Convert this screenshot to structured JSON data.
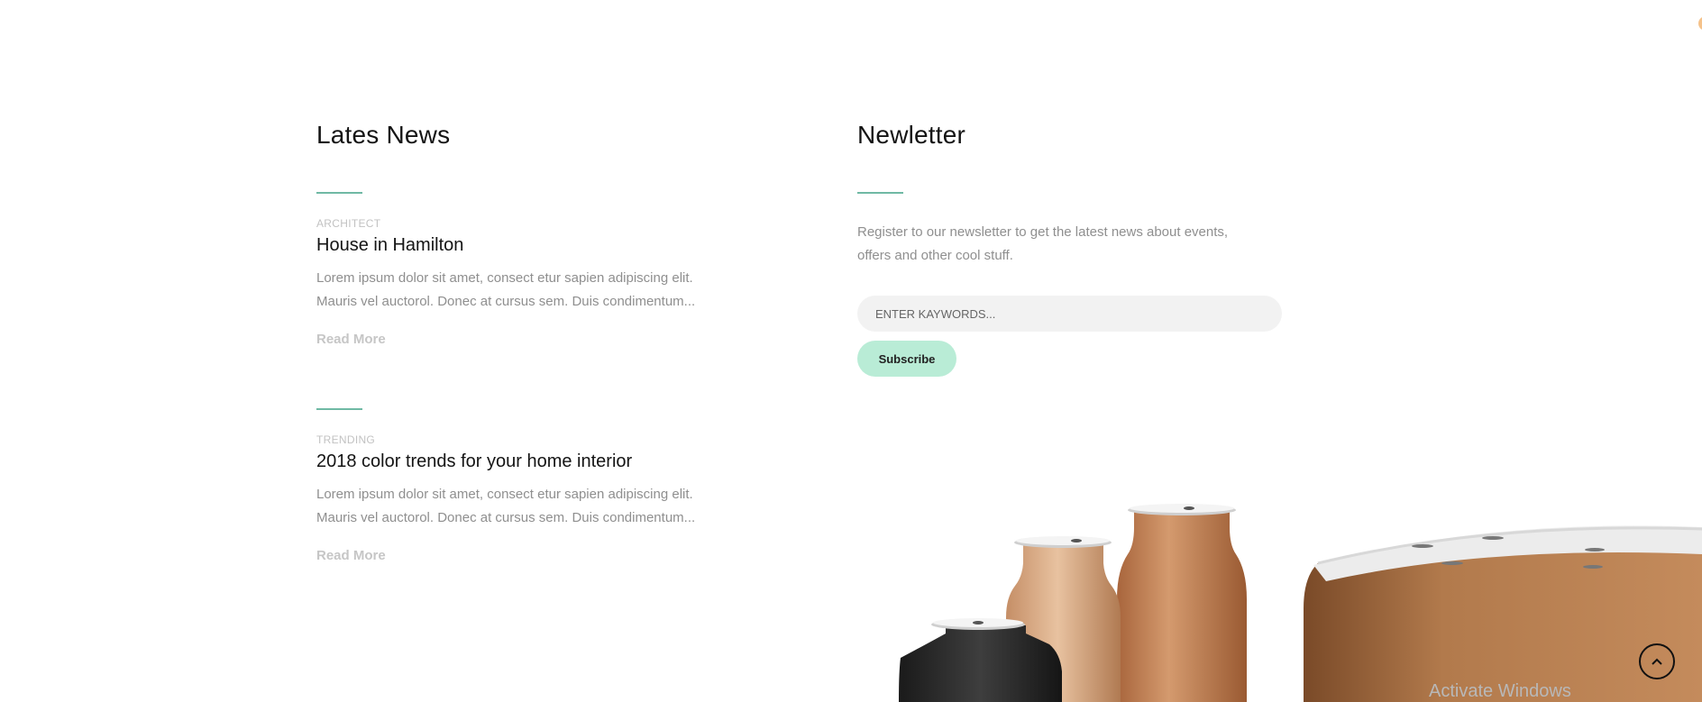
{
  "latest_news": {
    "title": "Lates News",
    "posts": [
      {
        "category": "ARCHITECT",
        "title": "House in Hamilton",
        "excerpt_line1": "Lorem ipsum dolor sit amet, consect etur sapien adipiscing elit.",
        "excerpt_line2": "Mauris vel auctorol. Donec at cursus sem. Duis condimentum...",
        "read_more": "Read More"
      },
      {
        "category": "TRENDING",
        "title": "2018 color trends for your home interior",
        "excerpt_line1": "Lorem ipsum dolor sit amet, consect etur sapien adipiscing elit.",
        "excerpt_line2": "Mauris vel auctorol. Donec at cursus sem. Duis condimentum...",
        "read_more": "Read More"
      }
    ]
  },
  "newsletter": {
    "title": "Newletter",
    "description_line1": "Register to our newsletter to get the latest news about events,",
    "description_line2": "offers and other cool stuff.",
    "input_placeholder": "ENTER KAYWORDS...",
    "input_value": "",
    "subscribe_label": "Subscribe"
  },
  "overlay": {
    "watermark": "Activate Windows"
  },
  "icons": {
    "scroll_top": "chevron-up-icon"
  },
  "colors": {
    "accent_line": "#6fb9a4",
    "subscribe_bg": "#b9ecd6",
    "input_bg": "#f2f2f2"
  }
}
